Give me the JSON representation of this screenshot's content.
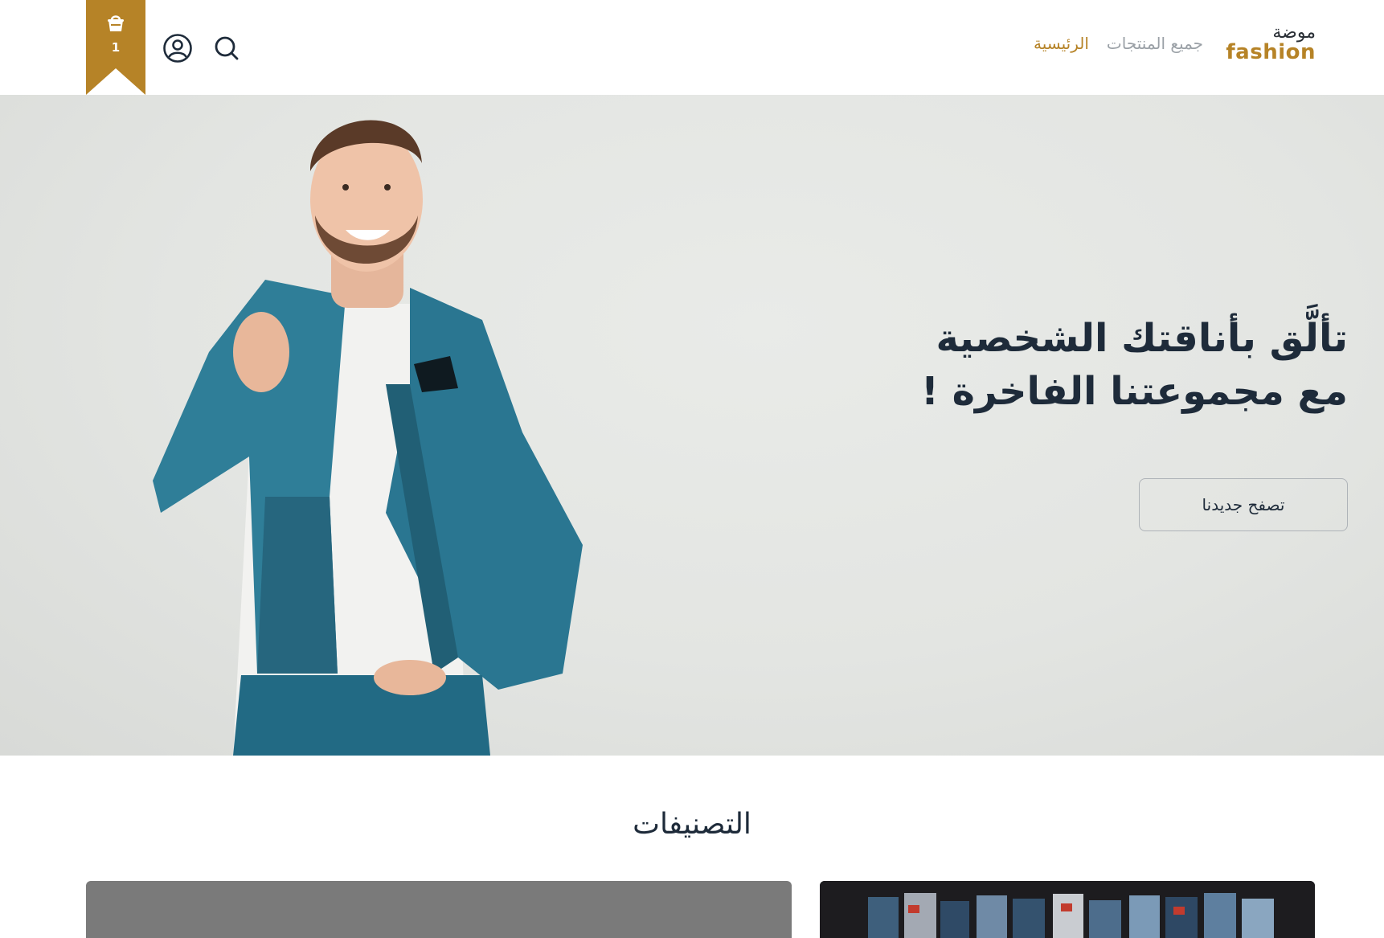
{
  "header": {
    "logo_ar": "موضة",
    "logo_en": "fashion",
    "nav": [
      {
        "label": "الرئيسية",
        "active": true
      },
      {
        "label": "جميع المنتجات",
        "active": false
      }
    ],
    "cart_count": "1",
    "icons": [
      "basket-icon",
      "user-icon",
      "search-icon"
    ]
  },
  "hero": {
    "title_line1": "تألَّق بأناقتك الشخصية",
    "title_line2": "مع مجموعتنا الفاخرة !",
    "button_label": "تصفح جديدنا"
  },
  "categories": {
    "title": "التصنيفات"
  },
  "colors": {
    "accent": "#b68327",
    "text_dark": "#1e2b3a",
    "nav_inactive": "#9aa0a6",
    "hero_bg": "#e3e5e2"
  }
}
